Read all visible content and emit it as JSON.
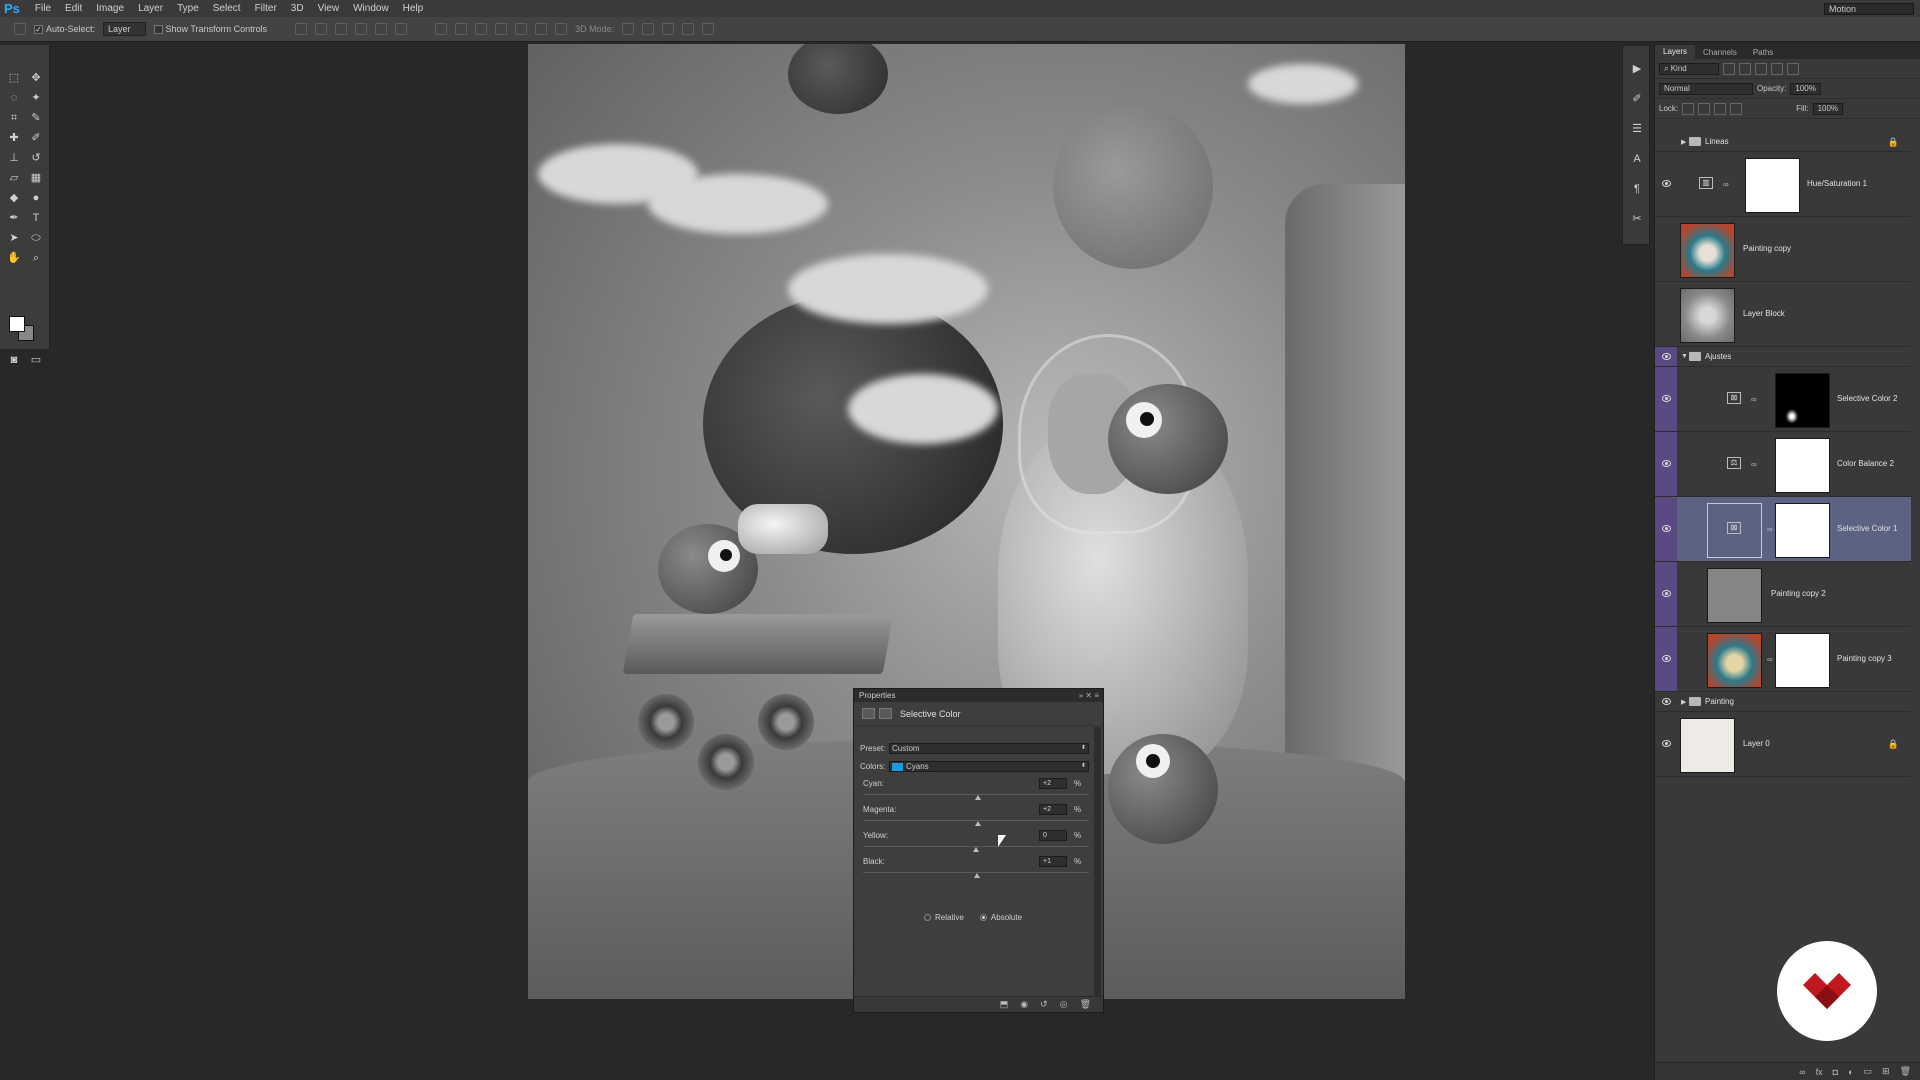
{
  "app": {
    "logo": "Ps"
  },
  "menu": [
    "File",
    "Edit",
    "Image",
    "Layer",
    "Type",
    "Select",
    "Filter",
    "3D",
    "View",
    "Window",
    "Help"
  ],
  "workspace": "Motion",
  "options": {
    "auto_select_label": "Auto-Select:",
    "auto_select_value": "Layer",
    "show_transform_label": "Show Transform Controls",
    "mode_3d_label": "3D Mode:"
  },
  "properties": {
    "tab_label": "Properties",
    "title": "Selective Color",
    "preset_label": "Preset:",
    "preset_value": "Custom",
    "colors_label": "Colors:",
    "colors_value": "Cyans",
    "sliders": [
      {
        "label": "Cyan:",
        "value": "+2",
        "level": 2
      },
      {
        "label": "Magenta:",
        "value": "+2",
        "level": 2
      },
      {
        "label": "Yellow:",
        "value": "0",
        "level": 0
      },
      {
        "label": "Black:",
        "value": "+1",
        "level": 1
      }
    ],
    "pct": "%",
    "relative_label": "Relative",
    "absolute_label": "Absolute"
  },
  "layers_panel": {
    "tabs": [
      "Layers",
      "Channels",
      "Paths"
    ],
    "kind_label": "Kind",
    "blend_mode": "Normal",
    "opacity_label": "Opacity:",
    "opacity_value": "100%",
    "lock_label": "Lock:",
    "fill_label": "Fill:",
    "fill_value": "100%",
    "layers": [
      {
        "name": "Lineas",
        "type": "group"
      },
      {
        "name": "Hue/Saturation 1",
        "type": "adjustment"
      },
      {
        "name": "Painting copy",
        "type": "image"
      },
      {
        "name": "Layer Block",
        "type": "image"
      },
      {
        "name": "Ajustes",
        "type": "group"
      },
      {
        "name": "Selective Color 2",
        "type": "adjustment"
      },
      {
        "name": "Color Balance 2",
        "type": "adjustment"
      },
      {
        "name": "Selective Color 1",
        "type": "adjustment",
        "selected": true
      },
      {
        "name": "Painting copy 2",
        "type": "image"
      },
      {
        "name": "Painting copy 3",
        "type": "image"
      },
      {
        "name": "Painting",
        "type": "group"
      },
      {
        "name": "Layer 0",
        "type": "image"
      }
    ]
  },
  "colors": {
    "accent_cyan": "#1e9bd8",
    "selected_layer": "#5b6282",
    "purple_strip": "#5a4a84",
    "logo_red": "#c0181e"
  }
}
